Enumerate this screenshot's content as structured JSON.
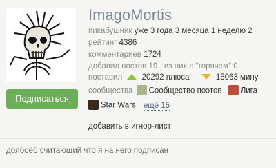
{
  "profile": {
    "username": "ImagoMortis",
    "subscribe_label": "Подписаться",
    "member_label": "пикабушник",
    "member_duration": "уже 3 года 3 месяца 1 неделю 2",
    "rating_label": "рейтинг",
    "rating_value": "4386",
    "comments_label": "комментариев",
    "comments_value": "1724",
    "posts_text": "добавил постов 19 , из них в \"горячем\" 0",
    "gave_label": "поставил",
    "pluses_text": "20292 плюса",
    "minuses_text": "15063 мину",
    "communities_label": "сообщества",
    "communities": [
      {
        "name": "Сообщество поэтов",
        "icon": "poets-community-icon",
        "color": "#a8b48a"
      },
      {
        "name": "Лига",
        "icon": "league-community-icon",
        "color": "#c24b3a"
      },
      {
        "name": "Star Wars",
        "icon": "star-wars-community-icon",
        "color": "#3a2a1a"
      }
    ],
    "more_communities": "ещё 15",
    "ignore_link": "добавить в игнор-лист",
    "bio": "долбоёб считающий что я на него подписан"
  },
  "colors": {
    "accent_green": "#6cae5a",
    "plus_green": "#8fc436",
    "minus_yellow": "#e9b42f",
    "username_color": "#7e8b94"
  }
}
